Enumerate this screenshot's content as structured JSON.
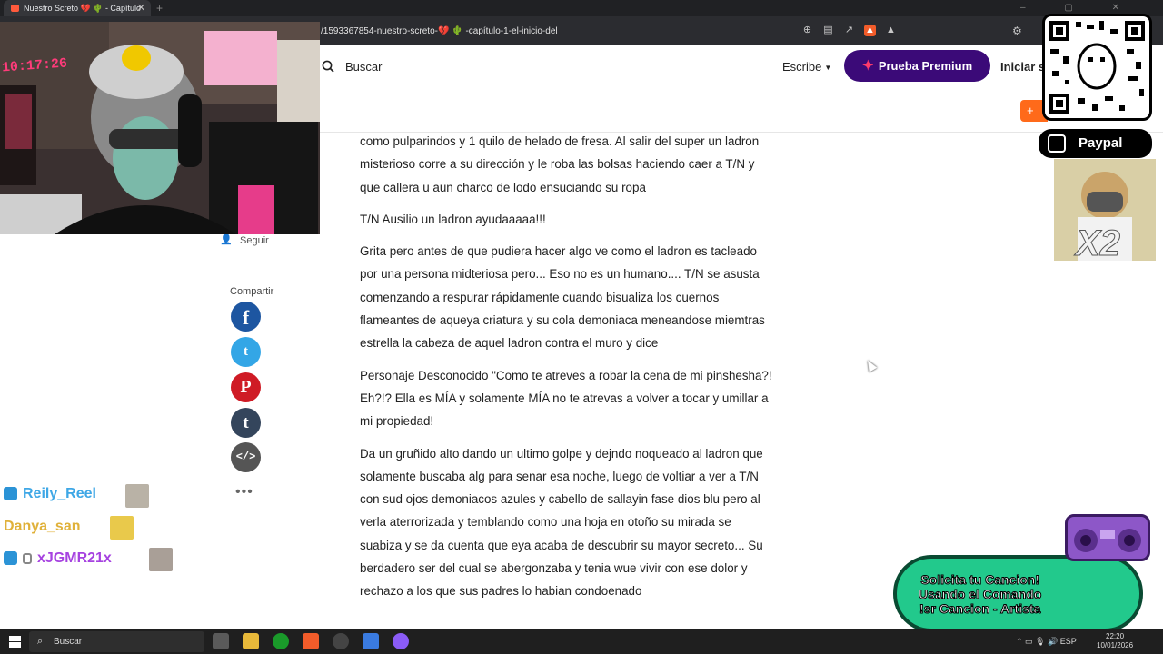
{
  "browser": {
    "tab_title": "Nuestro Screto 💔 🌵 - Capítulo",
    "tab_close": "✕",
    "new_tab": "+",
    "url_prefix": "/1593367854-nuestro-screto-",
    "url_heart": "💔",
    "url_cactus": "🌵",
    "url_suffix": "-capítulo-1-el-inicio-del"
  },
  "header": {
    "search_label": "Buscar",
    "write_label": "Escribe",
    "premium_label": "Prueba Premium",
    "login_label": "Iniciar s",
    "orange_label": "+"
  },
  "sidebar": {
    "follow_label": "Seguir",
    "share_label": "Compartir",
    "facebook_glyph": "f",
    "twitter_glyph": "t",
    "pinterest_glyph": "P",
    "tumblr_glyph": "t",
    "embed_glyph": "</>",
    "more_glyph": "•••"
  },
  "article": {
    "paragraphs": [
      "como pulparindos y 1 quilo de helado de fresa. Al salir del super un ladron misterioso corre a su dirección y le roba las bolsas haciendo caer a T/N y que callera u aun charco de lodo ensuciando su ropa",
      "T/N Ausilio un ladron ayudaaaaa!!!",
      "Grita pero antes de que pudiera hacer algo ve como el ladron es tacleado por una persona midteriosa pero... Eso no es un humano.... T/N se asusta comenzando a respurar rápidamente cuando bisualiza los cuernos flameantes de aqueya criatura y su cola demoniaca meneandose miemtras estrella la cabeza de aquel ladron contra el muro y dice",
      "Personaje Desconocido \"Como te atreves a robar la cena de mi pinshesha?! Eh?!? Ella es MÍA y solamente MÍA no te atrevas a volver a tocar y umillar a mi propiedad!",
      "Da un gruñido alto dando un ultimo golpe y dejndo noqueado al ladron que solamente buscaba alg para senar esa noche, luego de voltiar a ver a T/N con sud ojos demoniacos azules y cabello de sallayin fase dios blu pero al verla aterrorizada y temblando como una hoja en otoño su mirada se suabiza y se da cuenta que eya acaba de descubrir su mayor secreto... Su berdadero ser del cual se abergonzaba y tenia wue vivir con ese dolor y rechazo a los que sus padres lo habian condoenado"
    ]
  },
  "stream": {
    "cam_clock": "10:17:26",
    "chat": [
      {
        "name": "Reily_Reel"
      },
      {
        "name": "Danya_san"
      },
      {
        "name": "xJGMR21x"
      }
    ],
    "paypal_label": "Paypal",
    "x2_label": "X2",
    "song_request": "Solicita tu Cancion!\nUsando el Comando\n!sr Cancion - Artista"
  },
  "taskbar": {
    "search_label": "Buscar",
    "lang": "ESP",
    "time": "22:20",
    "date": "10/01/2026"
  },
  "colors": {
    "premium_bg": "#3b0a78",
    "orange": "#ff6a1a",
    "facebook": "#1d56a1",
    "twitter": "#33a6e6",
    "pinterest": "#cf1b25",
    "tumblr": "#34455c"
  }
}
